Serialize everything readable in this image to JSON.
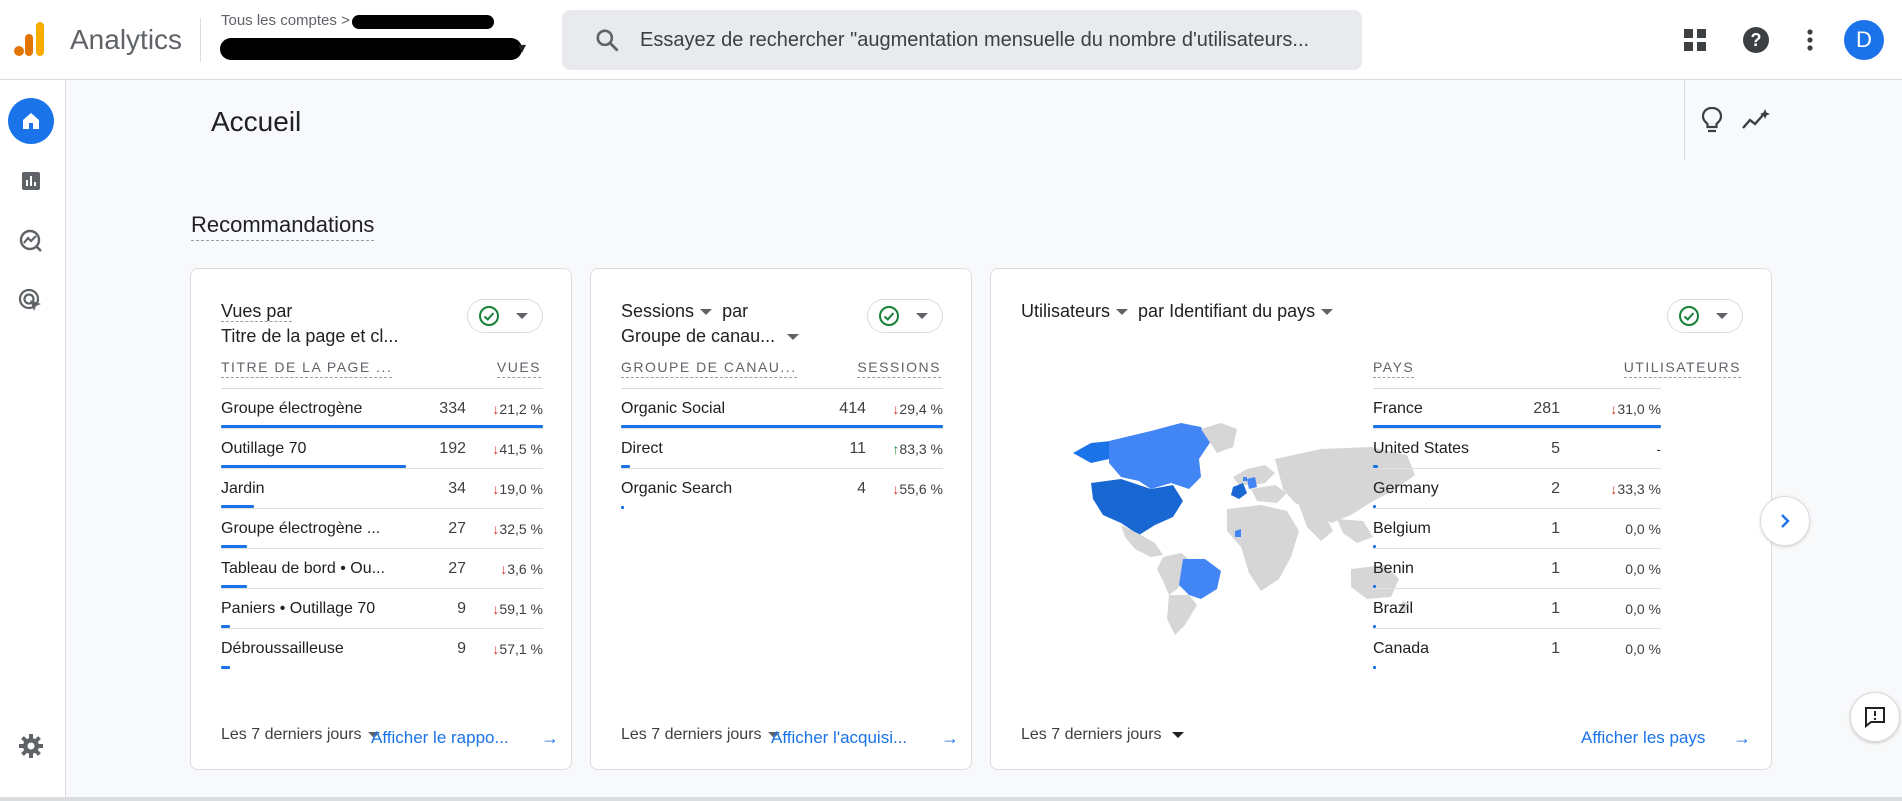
{
  "app": {
    "name": "Analytics",
    "logo_colors": [
      "#f9ab00",
      "#e37400",
      "#e37400"
    ]
  },
  "account": {
    "breadcrumb_label": "Tous les comptes",
    "breadcrumb_sep": ">"
  },
  "search": {
    "placeholder": "Essayez de rechercher \"augmentation mensuelle du nombre d'utilisateurs..."
  },
  "user": {
    "avatar_letter": "D",
    "avatar_color": "#1a73e8"
  },
  "page": {
    "title": "Accueil"
  },
  "section": {
    "title": "Recommandations"
  },
  "cards": [
    {
      "title_metric": "Vues par",
      "title_dim": "Titre de la page et cl...",
      "col_dim": "TITRE DE LA PAGE ...",
      "col_metric": "VUES",
      "rows": [
        {
          "label": "Groupe électrogène",
          "value": "334",
          "delta": "21,2 %",
          "dir": "down",
          "share": 1.0
        },
        {
          "label": "Outillage 70",
          "value": "192",
          "delta": "41,5 %",
          "dir": "down",
          "share": 0.575
        },
        {
          "label": "Jardin",
          "value": "34",
          "delta": "19,0 %",
          "dir": "down",
          "share": 0.102
        },
        {
          "label": "Groupe électrogène ...",
          "value": "27",
          "delta": "32,5 %",
          "dir": "down",
          "share": 0.081
        },
        {
          "label": "Tableau de bord • Ou...",
          "value": "27",
          "delta": "3,6 %",
          "dir": "down",
          "share": 0.081
        },
        {
          "label": "Paniers • Outillage 70",
          "value": "9",
          "delta": "59,1 %",
          "dir": "down",
          "share": 0.027
        },
        {
          "label": "Débroussailleuse",
          "value": "9",
          "delta": "57,1 %",
          "dir": "down",
          "share": 0.027
        }
      ],
      "range": "Les 7 derniers jours",
      "link": "Afficher le rappo..."
    },
    {
      "title_metric": "Sessions",
      "title_joiner": "par",
      "title_dim": "Groupe de canau...",
      "col_dim": "GROUPE DE CANAU...",
      "col_metric": "SESSIONS",
      "rows": [
        {
          "label": "Organic Social",
          "value": "414",
          "delta": "29,4 %",
          "dir": "down",
          "share": 1.0
        },
        {
          "label": "Direct",
          "value": "11",
          "delta": "83,3 %",
          "dir": "up",
          "share": 0.027
        },
        {
          "label": "Organic Search",
          "value": "4",
          "delta": "55,6 %",
          "dir": "down",
          "share": 0.01
        }
      ],
      "range": "Les 7 derniers jours",
      "link": "Afficher l'acquisi..."
    },
    {
      "title_metric": "Utilisateurs",
      "title_dim": "par Identifiant du pays",
      "col_dim": "PAYS",
      "col_metric": "UTILISATEURS",
      "rows": [
        {
          "label": "France",
          "value": "281",
          "delta": "31,0 %",
          "dir": "down",
          "share": 1.0
        },
        {
          "label": "United States",
          "value": "5",
          "delta": "-",
          "dir": "none",
          "share": 0.018
        },
        {
          "label": "Germany",
          "value": "2",
          "delta": "33,3 %",
          "dir": "down",
          "share": 0.007
        },
        {
          "label": "Belgium",
          "value": "1",
          "delta": "0,0 %",
          "dir": "none",
          "share": 0.004
        },
        {
          "label": "Benin",
          "value": "1",
          "delta": "0,0 %",
          "dir": "none",
          "share": 0.004
        },
        {
          "label": "Brazil",
          "value": "1",
          "delta": "0,0 %",
          "dir": "none",
          "share": 0.004
        },
        {
          "label": "Canada",
          "value": "1",
          "delta": "0,0 %",
          "dir": "none",
          "share": 0.004
        }
      ],
      "range": "Les 7 derniers jours",
      "link": "Afficher les pays"
    }
  ],
  "colors": {
    "accent": "#1a73e8",
    "down": "#d93025",
    "up": "#188038"
  }
}
